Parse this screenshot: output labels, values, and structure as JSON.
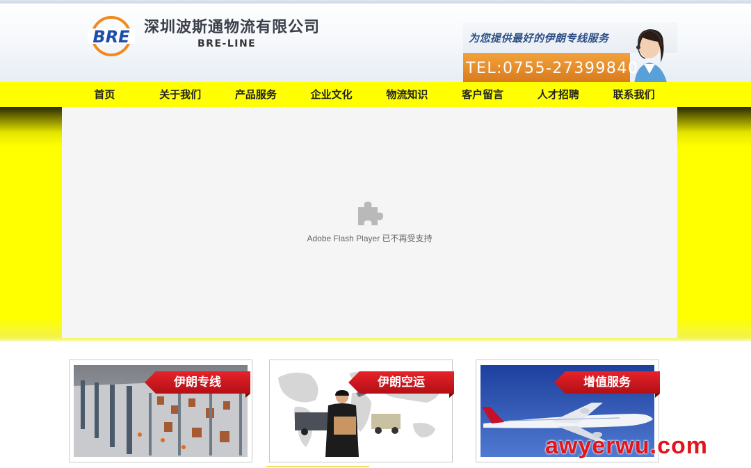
{
  "header": {
    "company_name": "深圳波斯通物流有限公司",
    "company_sub": "BRE-LINE",
    "logo_text": "BRE",
    "banner_slogan": "为您提供最好的伊朗专线服务",
    "banner_tel": "TEL:0755-27399840"
  },
  "nav": {
    "items": [
      {
        "label": "首页"
      },
      {
        "label": "关于我们"
      },
      {
        "label": "产品服务"
      },
      {
        "label": "企业文化"
      },
      {
        "label": "物流知识"
      },
      {
        "label": "客户留言"
      },
      {
        "label": "人才招聘"
      },
      {
        "label": "联系我们"
      }
    ]
  },
  "flash": {
    "message": "Adobe Flash Player 已不再受支持",
    "icon": "puzzle-piece-icon"
  },
  "cards": [
    {
      "label": "伊朗专线"
    },
    {
      "label": "伊朗空运"
    },
    {
      "label": "增值服务"
    }
  ],
  "watermark": "awyerwu.com",
  "colors": {
    "nav_background": "#ffff00",
    "tag_red": "#e8222a",
    "watermark_red": "#e3141a"
  }
}
